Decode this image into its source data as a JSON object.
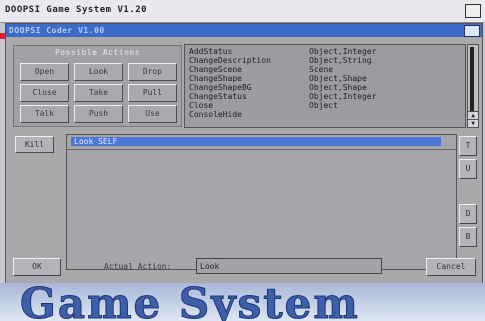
{
  "screen": {
    "title": "DOOPSI Game System V1.20"
  },
  "window": {
    "title": "DOOPSI Coder V1.00"
  },
  "actions": {
    "title": "Possible Actions",
    "buttons": [
      "Open",
      "Look",
      "Drop",
      "Close",
      "Take",
      "Pull",
      "Talk",
      "Push",
      "Use"
    ]
  },
  "commands": [
    {
      "name": "AddStatus",
      "args": "Object,Integer"
    },
    {
      "name": "ChangeDescription",
      "args": "Object,String"
    },
    {
      "name": "ChangeScene",
      "args": "Scene"
    },
    {
      "name": "ChangeShape",
      "args": "Object,Shape"
    },
    {
      "name": "ChangeShapeBG",
      "args": "Object,Shape"
    },
    {
      "name": "ChangeStatus",
      "args": "Object,Integer"
    },
    {
      "name": "Close",
      "args": "Object"
    },
    {
      "name": "ConsoleHide",
      "args": ""
    }
  ],
  "kill_label": "Kill",
  "script": {
    "line": "Look SELF"
  },
  "side_buttons": [
    "T",
    "U",
    "D",
    "B"
  ],
  "bottom": {
    "ok": "OK",
    "label": "Actual Action:",
    "value": "Look",
    "cancel": "Cancel"
  },
  "logo": "Game System",
  "colors": {
    "title_bar": "#3c6cc8",
    "selection": "#4a78d4",
    "logo": "#3f5ea8"
  }
}
